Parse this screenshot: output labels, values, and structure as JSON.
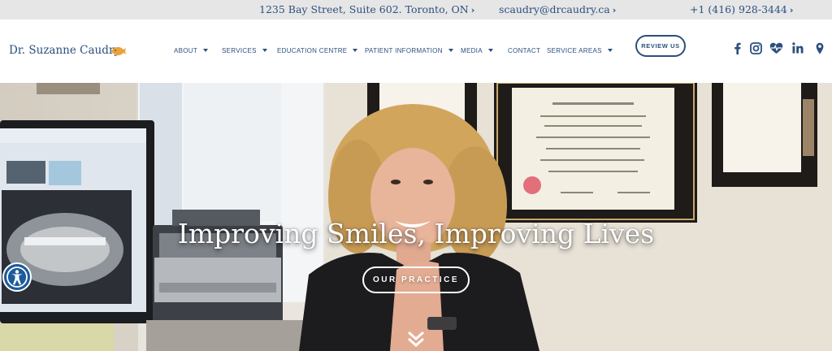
{
  "topbar": {
    "address": "1235 Bay Street, Suite 602. Toronto, ON",
    "email": "scaudry@drcaudry.ca",
    "phone": "+1 (416) 928-3444",
    "chevron": "›"
  },
  "header": {
    "logo_text": "Dr. Suzanne Caudry",
    "nav": [
      {
        "label": "ABOUT",
        "dropdown": true
      },
      {
        "label": "SERVICES",
        "dropdown": true
      },
      {
        "label": "EDUCATION CENTRE",
        "dropdown": true
      },
      {
        "label": "PATIENT INFORMATION",
        "dropdown": true
      },
      {
        "label": "MEDIA",
        "dropdown": true
      },
      {
        "label": "CONTACT",
        "dropdown": false
      },
      {
        "label": "SERVICE AREAS",
        "dropdown": true
      }
    ],
    "review_button": "REVIEW US",
    "social": [
      "facebook-icon",
      "instagram-icon",
      "heart-pulse-icon",
      "linkedin-icon",
      "map-pin-icon"
    ]
  },
  "hero": {
    "title": "Improving Smiles, Improving Lives",
    "button": "OUR PRACTICE"
  },
  "colors": {
    "brand_navy": "#2b4f7e",
    "topbar_bg": "#e6e6e6",
    "accessibility_blue": "#1d5a9c",
    "logo_gold": "#e8a33a"
  }
}
